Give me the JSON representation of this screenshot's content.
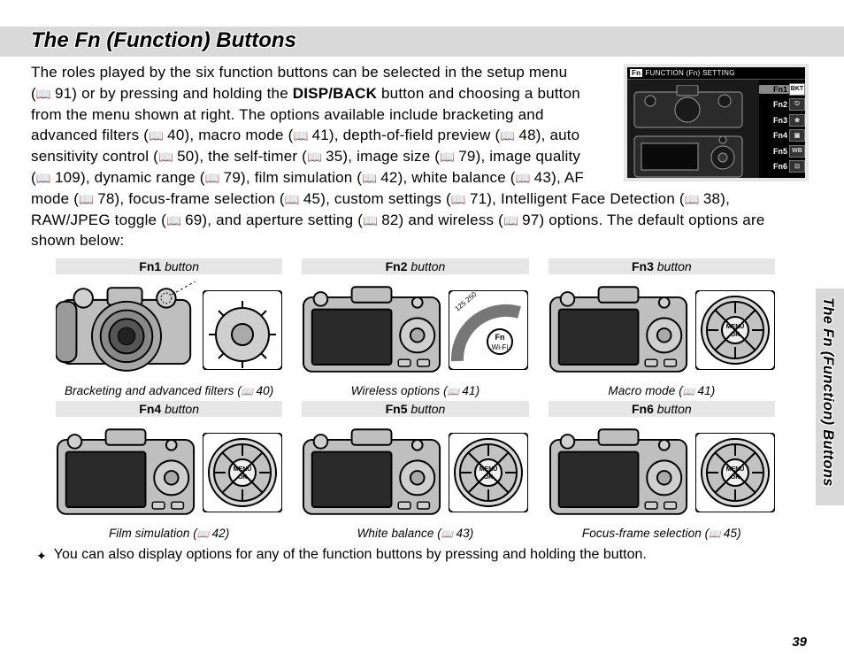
{
  "title": "The Fn (Function) Buttons",
  "side_title": "The Fn (Function) Buttons",
  "page_number": "39",
  "intro": {
    "p1a": "The roles played by the six function buttons can be selected in the setup menu (",
    "ref91": "91",
    "p1b": ") or by pressing and holding the ",
    "dispback": "DISP/BACK",
    "p1c": " button and choosing a button from the menu shown at right.  The options available include bracketing and advanced filters (",
    "ref40": "40",
    "p1d": "), macro mode (",
    "ref41a": "41",
    "p1e": "), depth-of-field preview (",
    "ref48": "48",
    "p1f": "), auto sensitivity control (",
    "ref50": "50",
    "p1g": "), the self-timer (",
    "ref35": "35",
    "p1h": "), image size (",
    "ref79a": "79",
    "p1i": "), image quality (",
    "ref109": "109",
    "p1j": "), dynamic range (",
    "ref79b": "79",
    "p1k": "), film simulation (",
    "ref42": "42",
    "p1l": "), white balance (",
    "ref43": "43",
    "p1m": "), AF mode (",
    "ref78": "78",
    "p1n": "), focus-frame selection (",
    "ref45": "45",
    "p1o": "), custom settings (",
    "ref71": "71",
    "p1p": "), Intelligent Face Detection (",
    "ref38": "38",
    "p1q": "), RAW/JPEG toggle (",
    "ref69": "69",
    "p1r": "), and aperture setting (",
    "ref82": "82",
    "p1s": ") and wireless (",
    "ref97": "97",
    "p1t": ") options. The default options are shown below:"
  },
  "lcd": {
    "title_chip": "Fn",
    "title_text": "FUNCTION (Fn) SETTING",
    "rows": [
      {
        "label": "Fn1",
        "icon": "BKT",
        "sel": true
      },
      {
        "label": "Fn2",
        "icon": "⎋"
      },
      {
        "label": "Fn3",
        "icon": "❀"
      },
      {
        "label": "Fn4",
        "icon": "▣"
      },
      {
        "label": "Fn5",
        "icon": "WB"
      },
      {
        "label": "Fn6",
        "icon": "⊡"
      }
    ]
  },
  "cells": [
    {
      "head_b": "Fn1",
      "head_i": " button",
      "caption_a": "Bracketing and advanced filters (",
      "ref": "40",
      "caption_b": ")",
      "svg": "front"
    },
    {
      "head_b": "Fn2",
      "head_i": " button",
      "caption_a": "Wireless options (",
      "ref": "41",
      "caption_b": ")",
      "svg": "back-wifi"
    },
    {
      "head_b": "Fn3",
      "head_i": " button",
      "caption_a": "Macro mode (",
      "ref": "41",
      "caption_b": ")",
      "svg": "back-dpad"
    },
    {
      "head_b": "Fn4",
      "head_i": " button",
      "caption_a": "Film simulation (",
      "ref": "42",
      "caption_b": ")",
      "svg": "back-dpad"
    },
    {
      "head_b": "Fn5",
      "head_i": " button",
      "caption_a": "White balance (",
      "ref": "43",
      "caption_b": ")",
      "svg": "back-dpad"
    },
    {
      "head_b": "Fn6",
      "head_i": " button",
      "caption_a": "Focus-frame selection (",
      "ref": "45",
      "caption_b": ")",
      "svg": "back-dpad"
    }
  ],
  "note_bullet": "✦",
  "note_text": "You can also display options for any of the function buttons by pressing and holding the button."
}
